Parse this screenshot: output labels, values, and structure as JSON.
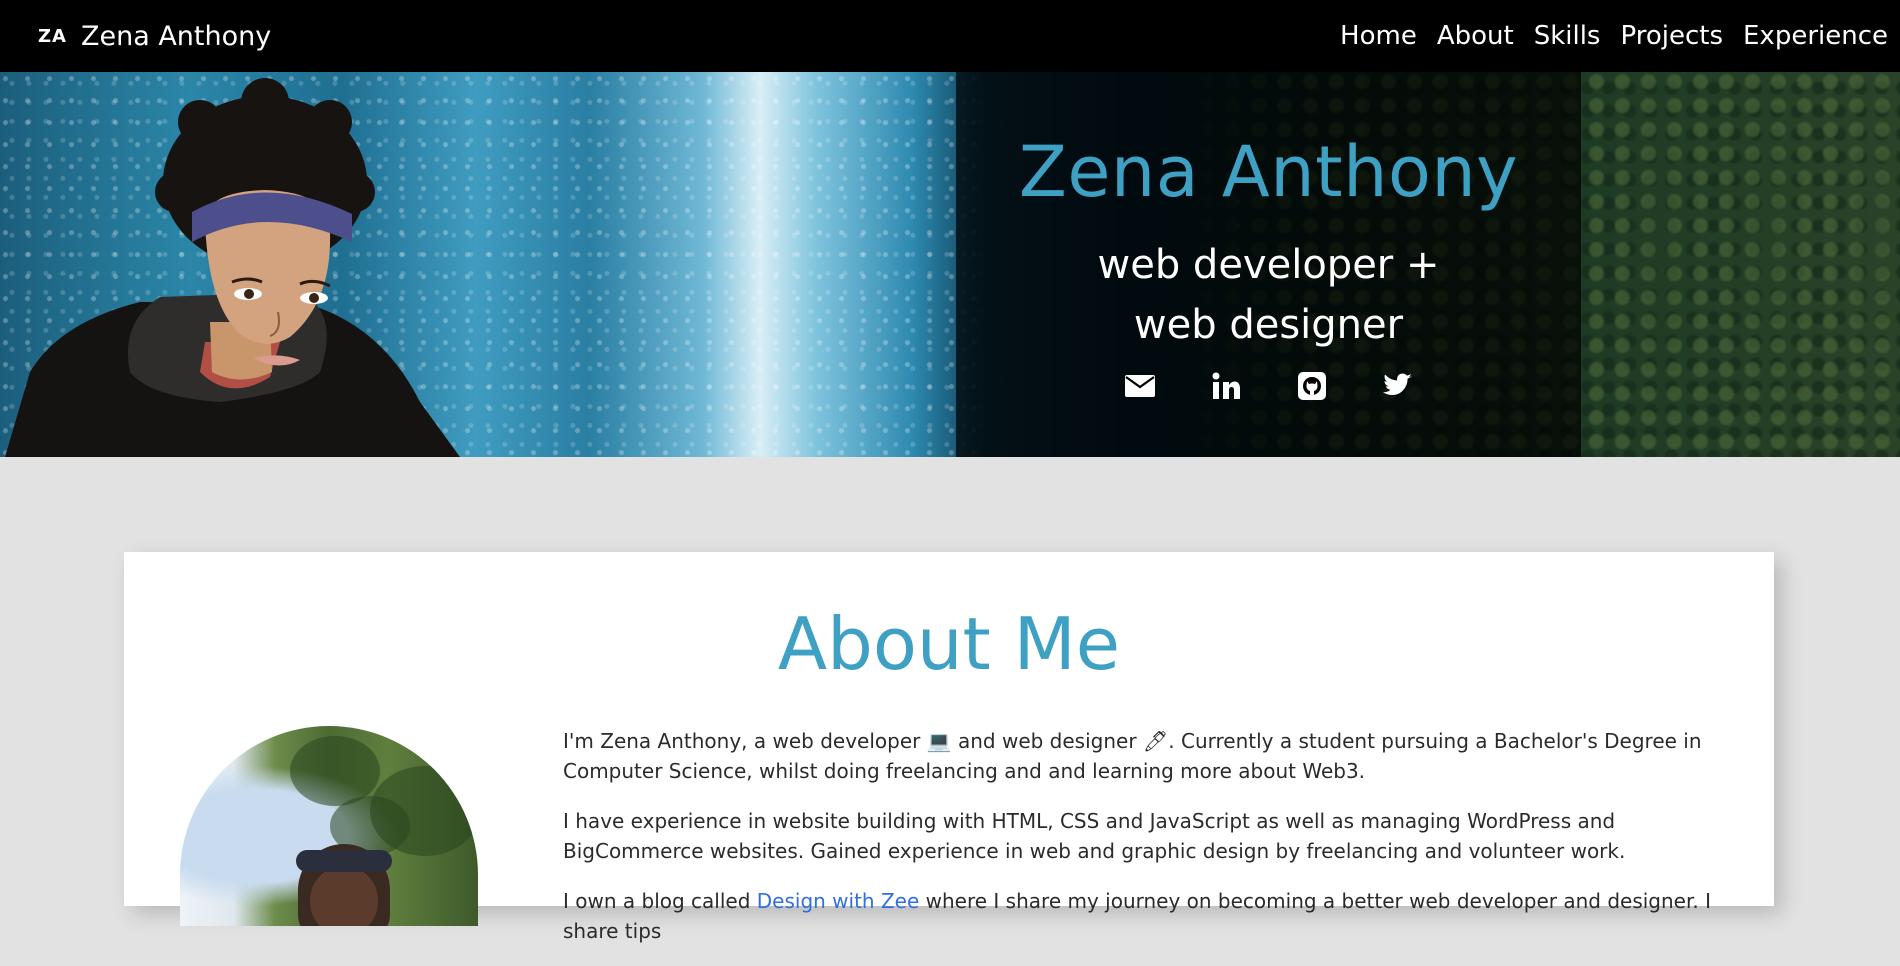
{
  "navbar": {
    "logo_text": "ZA",
    "brand_name": "Zena Anthony",
    "links": [
      {
        "label": "Home"
      },
      {
        "label": "About"
      },
      {
        "label": "Skills"
      },
      {
        "label": "Projects"
      },
      {
        "label": "Experience"
      }
    ]
  },
  "hero": {
    "name": "Zena Anthony",
    "tagline": "web developer + web designer",
    "social": [
      {
        "icon": "envelope-icon"
      },
      {
        "icon": "linkedin-icon"
      },
      {
        "icon": "github-icon"
      },
      {
        "icon": "twitter-icon"
      }
    ]
  },
  "about": {
    "title": "About Me",
    "paragraph1": "I'm Zena Anthony, a web developer 💻 and web designer 🖊. Currently a student pursuing a Bachelor's Degree in Computer Science, whilst doing freelancing and and learning more about Web3.",
    "paragraph2": "I have experience in website building with HTML, CSS and JavaScript as well as managing WordPress and BigCommerce websites. Gained experience in web and graphic design by freelancing and volunteer work.",
    "paragraph3_before": "I own a blog called ",
    "blog_link": "Design with Zee",
    "paragraph3_after": " where I share my journey on becoming a better web developer and designer. I share tips"
  },
  "colors": {
    "accent": "#3ea0c2",
    "navbar_bg": "#000000",
    "page_bg": "#e2e2e2",
    "link": "#2f6fe0"
  }
}
